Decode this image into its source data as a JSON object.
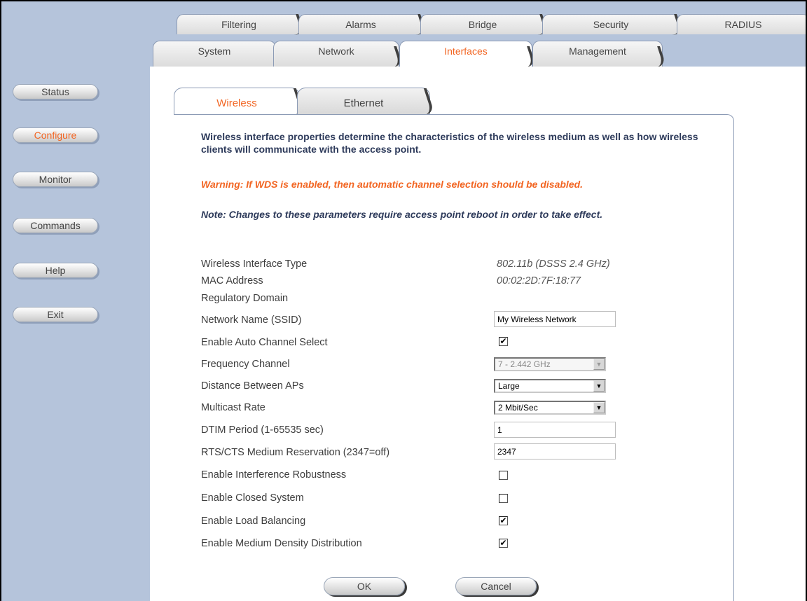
{
  "sidebar": {
    "buttons": [
      "Status",
      "Configure",
      "Monitor",
      "Commands",
      "Help",
      "Exit"
    ],
    "active": "Configure"
  },
  "tabs": {
    "row1": [
      "Filtering",
      "Alarms",
      "Bridge",
      "Security",
      "RADIUS"
    ],
    "row2": [
      "System",
      "Network",
      "Interfaces",
      "Management"
    ],
    "active": "Interfaces"
  },
  "subtabs": {
    "items": [
      "Wireless",
      "Ethernet"
    ],
    "active": "Wireless"
  },
  "intro": "Wireless interface properties determine the characteristics of the wireless medium as well as how wireless clients will communicate with the access point.",
  "warning": "Warning: If WDS is enabled, then automatic channel selection should be disabled.",
  "note": "Note: Changes to these parameters require access point reboot in order to take effect.",
  "fields": {
    "iface_type": {
      "label": "Wireless Interface Type",
      "value": "802.11b (DSSS 2.4 GHz)"
    },
    "mac": {
      "label": "MAC Address",
      "value": "00:02:2D:7F:18:77"
    },
    "reg_domain": {
      "label": "Regulatory Domain"
    },
    "ssid": {
      "label": "Network Name (SSID)",
      "value": "My Wireless Network"
    },
    "auto_channel": {
      "label": "Enable Auto Channel Select",
      "checked": true
    },
    "freq_channel": {
      "label": "Frequency Channel",
      "value": "7 - 2.442 GHz"
    },
    "distance": {
      "label": "Distance Between APs",
      "value": "Large"
    },
    "multicast": {
      "label": "Multicast Rate",
      "value": "2 Mbit/Sec"
    },
    "dtim": {
      "label": "DTIM Period (1-65535 sec)",
      "value": "1"
    },
    "rts": {
      "label": "RTS/CTS Medium Reservation (2347=off)",
      "value": "2347"
    },
    "interference": {
      "label": "Enable Interference Robustness",
      "checked": false
    },
    "closed_system": {
      "label": "Enable Closed System",
      "checked": false
    },
    "load_balancing": {
      "label": "Enable Load Balancing",
      "checked": true
    },
    "medium_density": {
      "label": "Enable Medium Density Distribution",
      "checked": true
    }
  },
  "actions": {
    "ok": "OK",
    "cancel": "Cancel"
  },
  "colors": {
    "accent": "#f26522",
    "sidebar_bg": "#b5c4db",
    "heading_text": "#2e3b5b"
  }
}
